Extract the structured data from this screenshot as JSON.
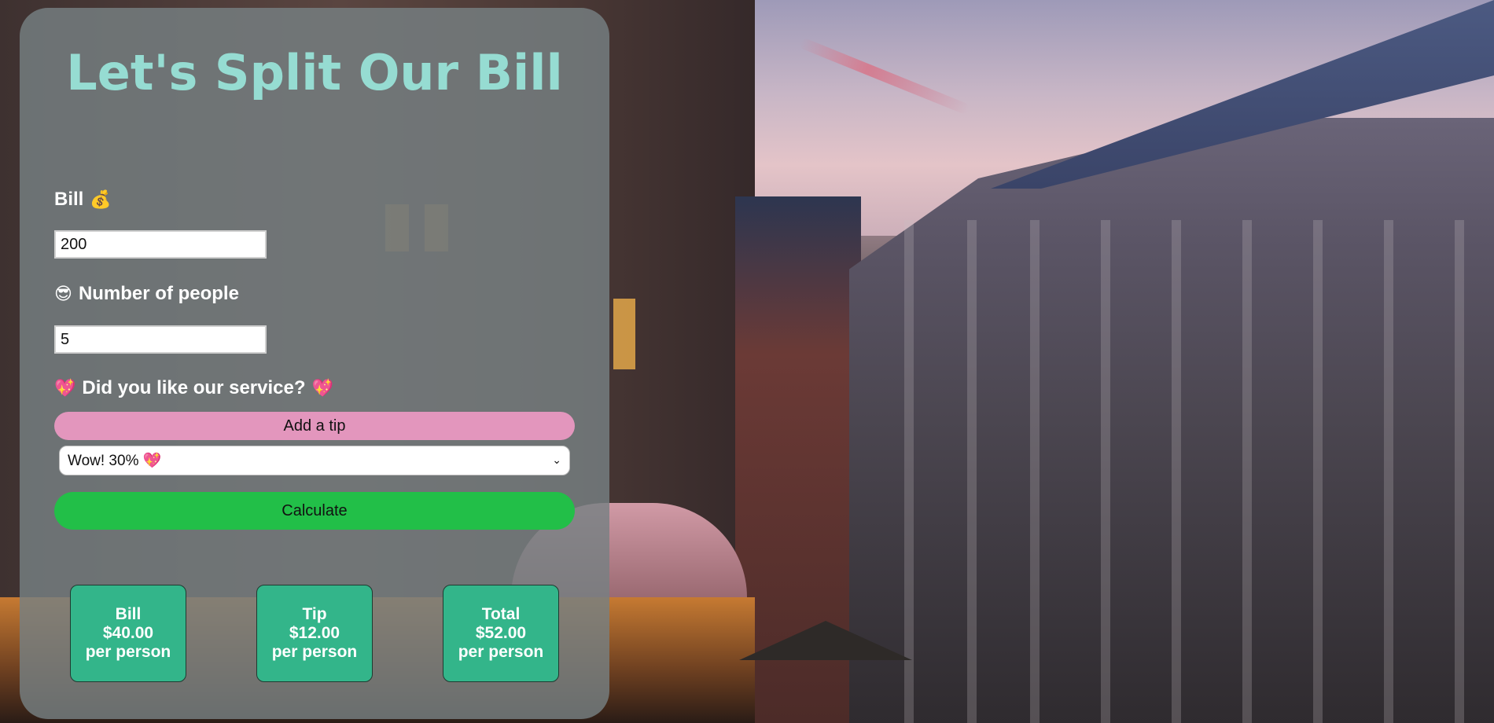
{
  "app": {
    "title": "Let's Split Our Bill"
  },
  "bill": {
    "label": "Bill",
    "icon": "money-bag-icon",
    "icon_glyph": "💰",
    "value": "200"
  },
  "people": {
    "label": "Number of people",
    "icon": "smiling-face-with-sunglasses-icon",
    "icon_glyph": "😎",
    "value": "5"
  },
  "service": {
    "question": "Did you like our service?",
    "icon": "sparkling-heart-icon",
    "icon_glyph": "💖"
  },
  "tip": {
    "button_label": "Add a tip",
    "selected_option": "Wow! 30% 💖"
  },
  "calculate": {
    "button_label": "Calculate"
  },
  "results": [
    {
      "title": "Bill",
      "amount": "$40.00",
      "suffix": "per person"
    },
    {
      "title": "Tip",
      "amount": "$12.00",
      "suffix": "per person"
    },
    {
      "title": "Total",
      "amount": "$52.00",
      "suffix": "per person"
    }
  ],
  "colors": {
    "title": "#96dcd2",
    "tip_button": "#e396bd",
    "calculate_button": "#22bf48",
    "result_card": "#33b58a"
  }
}
